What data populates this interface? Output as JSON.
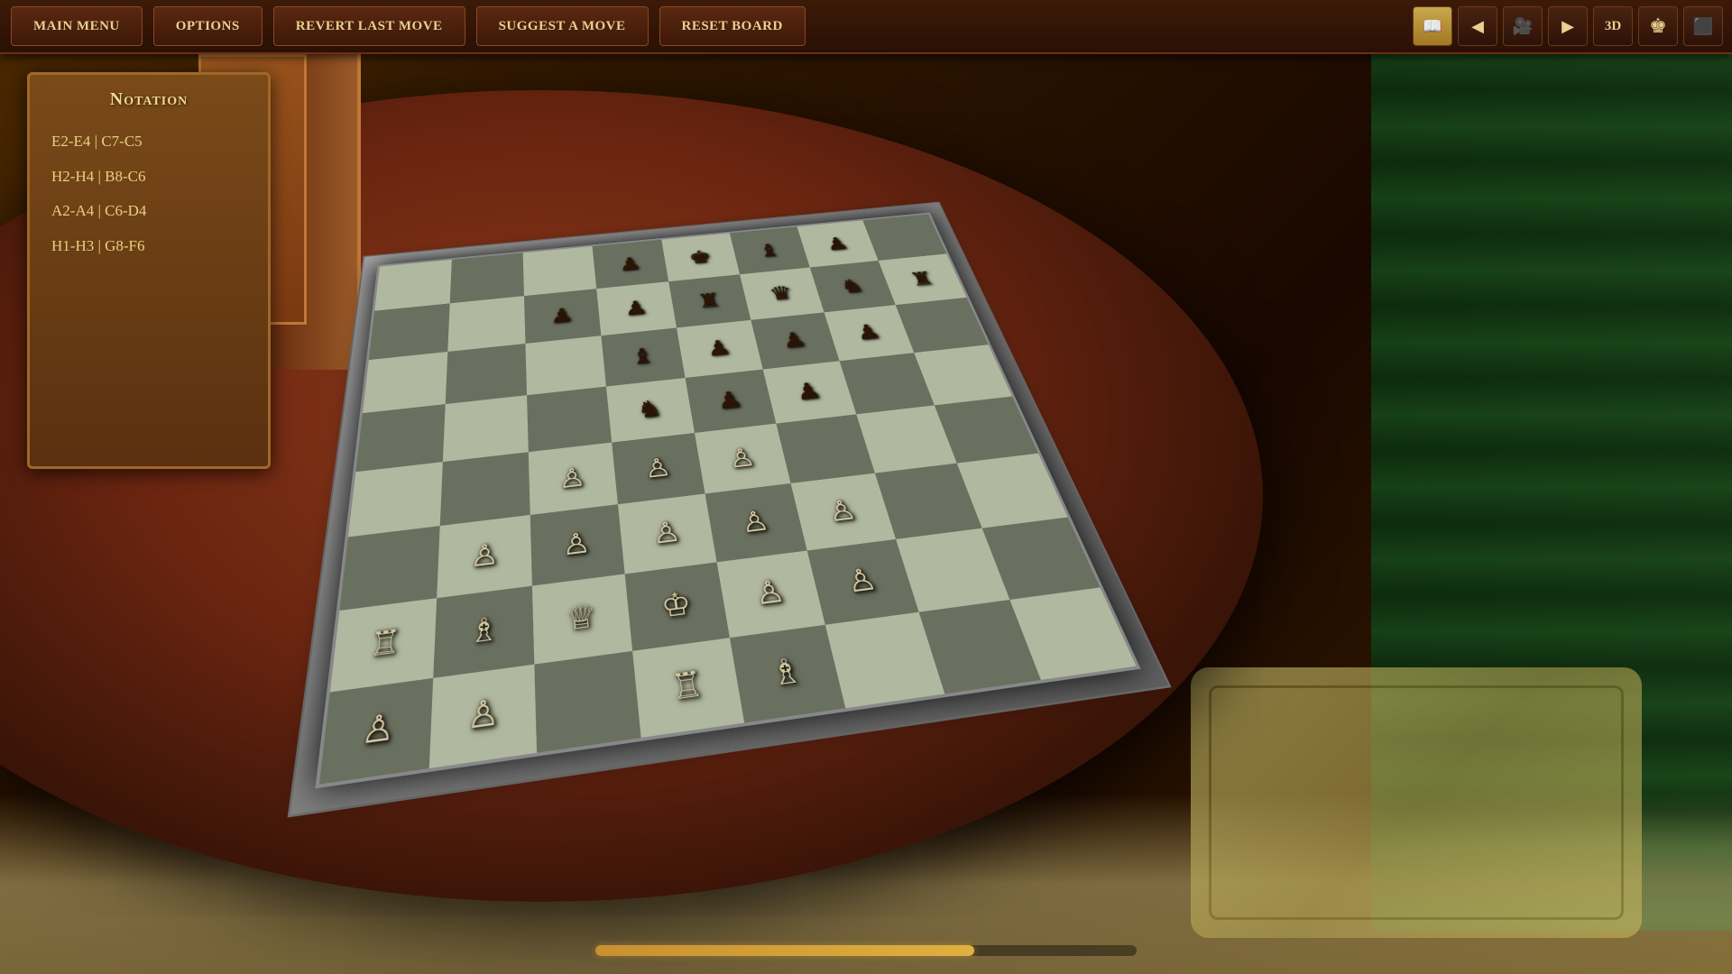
{
  "navbar": {
    "main_menu_label": "Main Menu",
    "options_label": "Options",
    "revert_label": "Revert Last Move",
    "suggest_label": "Suggest a Move",
    "reset_label": "Reset Board",
    "toggle_3d_label": "3D",
    "prev_icon": "◀",
    "next_icon": "▶",
    "camera_icon": "🎥",
    "book_icon": "📖",
    "king_icon": "♚",
    "checkerboard_icon": "⬛"
  },
  "notation": {
    "title": "Notation",
    "moves": [
      "E2-E4 | C7-C5",
      "H2-H4 | B8-C6",
      "A2-A4 | C6-D4",
      "H1-H3 | G8-F6"
    ]
  },
  "progress": {
    "value": 70
  },
  "board": {
    "label": "Chess Board"
  }
}
